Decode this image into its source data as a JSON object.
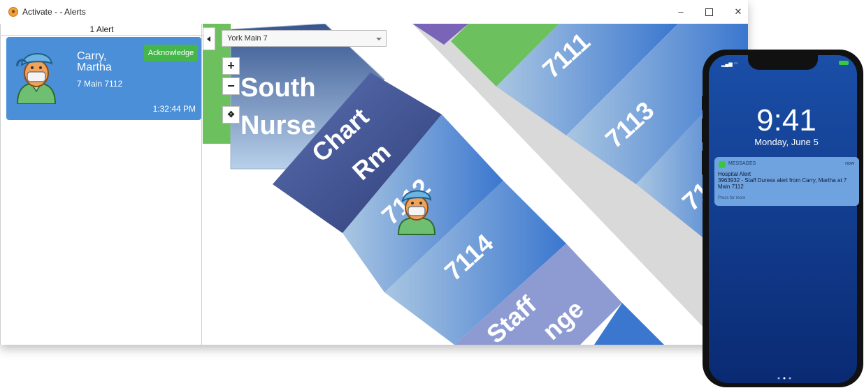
{
  "window": {
    "title": "Activate - - Alerts",
    "minimize_symbol": "–",
    "close_symbol": "✕"
  },
  "alerts_panel": {
    "count_label": "1 Alert",
    "alerts": [
      {
        "name": "Carry, Martha",
        "location": "7 Main 7112",
        "time": "1:32:44 PM",
        "acknowledge_label": "Acknowledge",
        "avatar_icon": "nurse-avatar-icon"
      }
    ],
    "card_color": "#4a8fd8",
    "acknowledge_color": "#45b649"
  },
  "map": {
    "floor_selected": "York Main 7",
    "zoom_in_label": "+",
    "zoom_out_label": "−",
    "locate_icon": "locate-icon",
    "rooms": {
      "south_nurse": [
        "South",
        "Nurse"
      ],
      "chart_rm": [
        "Chart",
        "Rm"
      ],
      "r7111": "7111",
      "r7112": "7112",
      "r7113": "7113",
      "r7114": "7114",
      "r71_partial": "71",
      "staff_lounge": [
        "Staff",
        "nge"
      ],
      "top_fragment": "7"
    }
  },
  "phone": {
    "time": "9:41",
    "date": "Monday, June 5",
    "notification": {
      "app": "MESSAGES",
      "when": "now",
      "title": "Hospital Alert",
      "body": "3963932 - Staff Duress alert from Carry, Martha at 7 Main 7112",
      "more": "Press for more"
    }
  }
}
